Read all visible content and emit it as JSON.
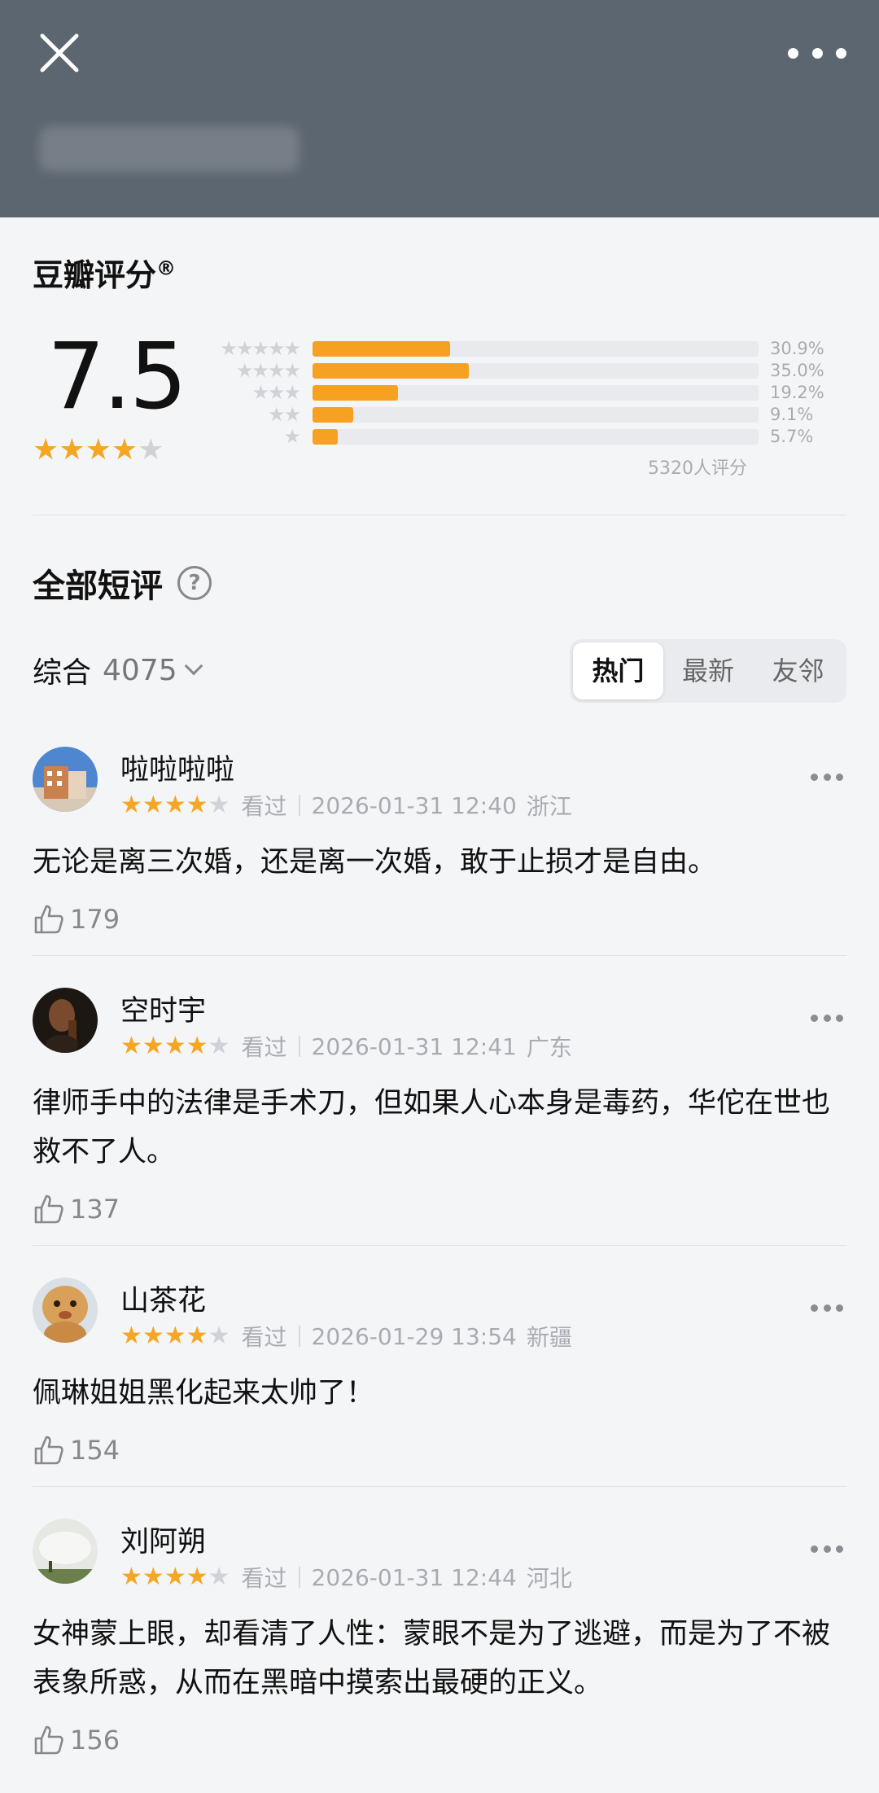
{
  "header": {
    "close_icon": "close-icon",
    "more_icon": "more-horizontal-icon"
  },
  "rating": {
    "title": "豆瓣评分",
    "title_mark": "®",
    "score": "7.5",
    "score_stars": 4,
    "distribution": [
      {
        "stars": 5,
        "percent_text": "30.9%",
        "fraction": 0.309
      },
      {
        "stars": 4,
        "percent_text": "35.0%",
        "fraction": 0.35
      },
      {
        "stars": 3,
        "percent_text": "19.2%",
        "fraction": 0.192
      },
      {
        "stars": 2,
        "percent_text": "9.1%",
        "fraction": 0.091
      },
      {
        "stars": 1,
        "percent_text": "5.7%",
        "fraction": 0.057
      }
    ],
    "total": "5320人评分",
    "accent_color": "#f6a121"
  },
  "reviews_section": {
    "title": "全部短评",
    "help_icon": "question-circle-icon",
    "sort_label": "综合",
    "count": "4075",
    "tabs": [
      {
        "label": "热门",
        "active": true
      },
      {
        "label": "最新",
        "active": false
      },
      {
        "label": "友邻",
        "active": false
      }
    ]
  },
  "comments": [
    {
      "name": "啦啦啦啦",
      "stars": 4,
      "status": "看过",
      "datetime": "2026-01-31 12:40",
      "location": "浙江",
      "text": "无论是离三次婚，还是离一次婚，敢于止损才是自由。",
      "likes": "179"
    },
    {
      "name": "空时宇",
      "stars": 4,
      "status": "看过",
      "datetime": "2026-01-31 12:41",
      "location": "广东",
      "text": "律师手中的法律是手术刀，但如果人心本身是毒药，华佗在世也救不了人。",
      "likes": "137"
    },
    {
      "name": "山茶花",
      "stars": 4,
      "status": "看过",
      "datetime": "2026-01-29 13:54",
      "location": "新疆",
      "text": "佩琳姐姐黑化起来太帅了！",
      "likes": "154"
    },
    {
      "name": "刘阿朔",
      "stars": 4,
      "status": "看过",
      "datetime": "2026-01-31 12:44",
      "location": "河北",
      "text": "女神蒙上眼，却看清了人性：蒙眼不是为了逃避，而是为了不被表象所惑，从而在黑暗中摸索出最硬的正义。",
      "likes": "156"
    }
  ]
}
